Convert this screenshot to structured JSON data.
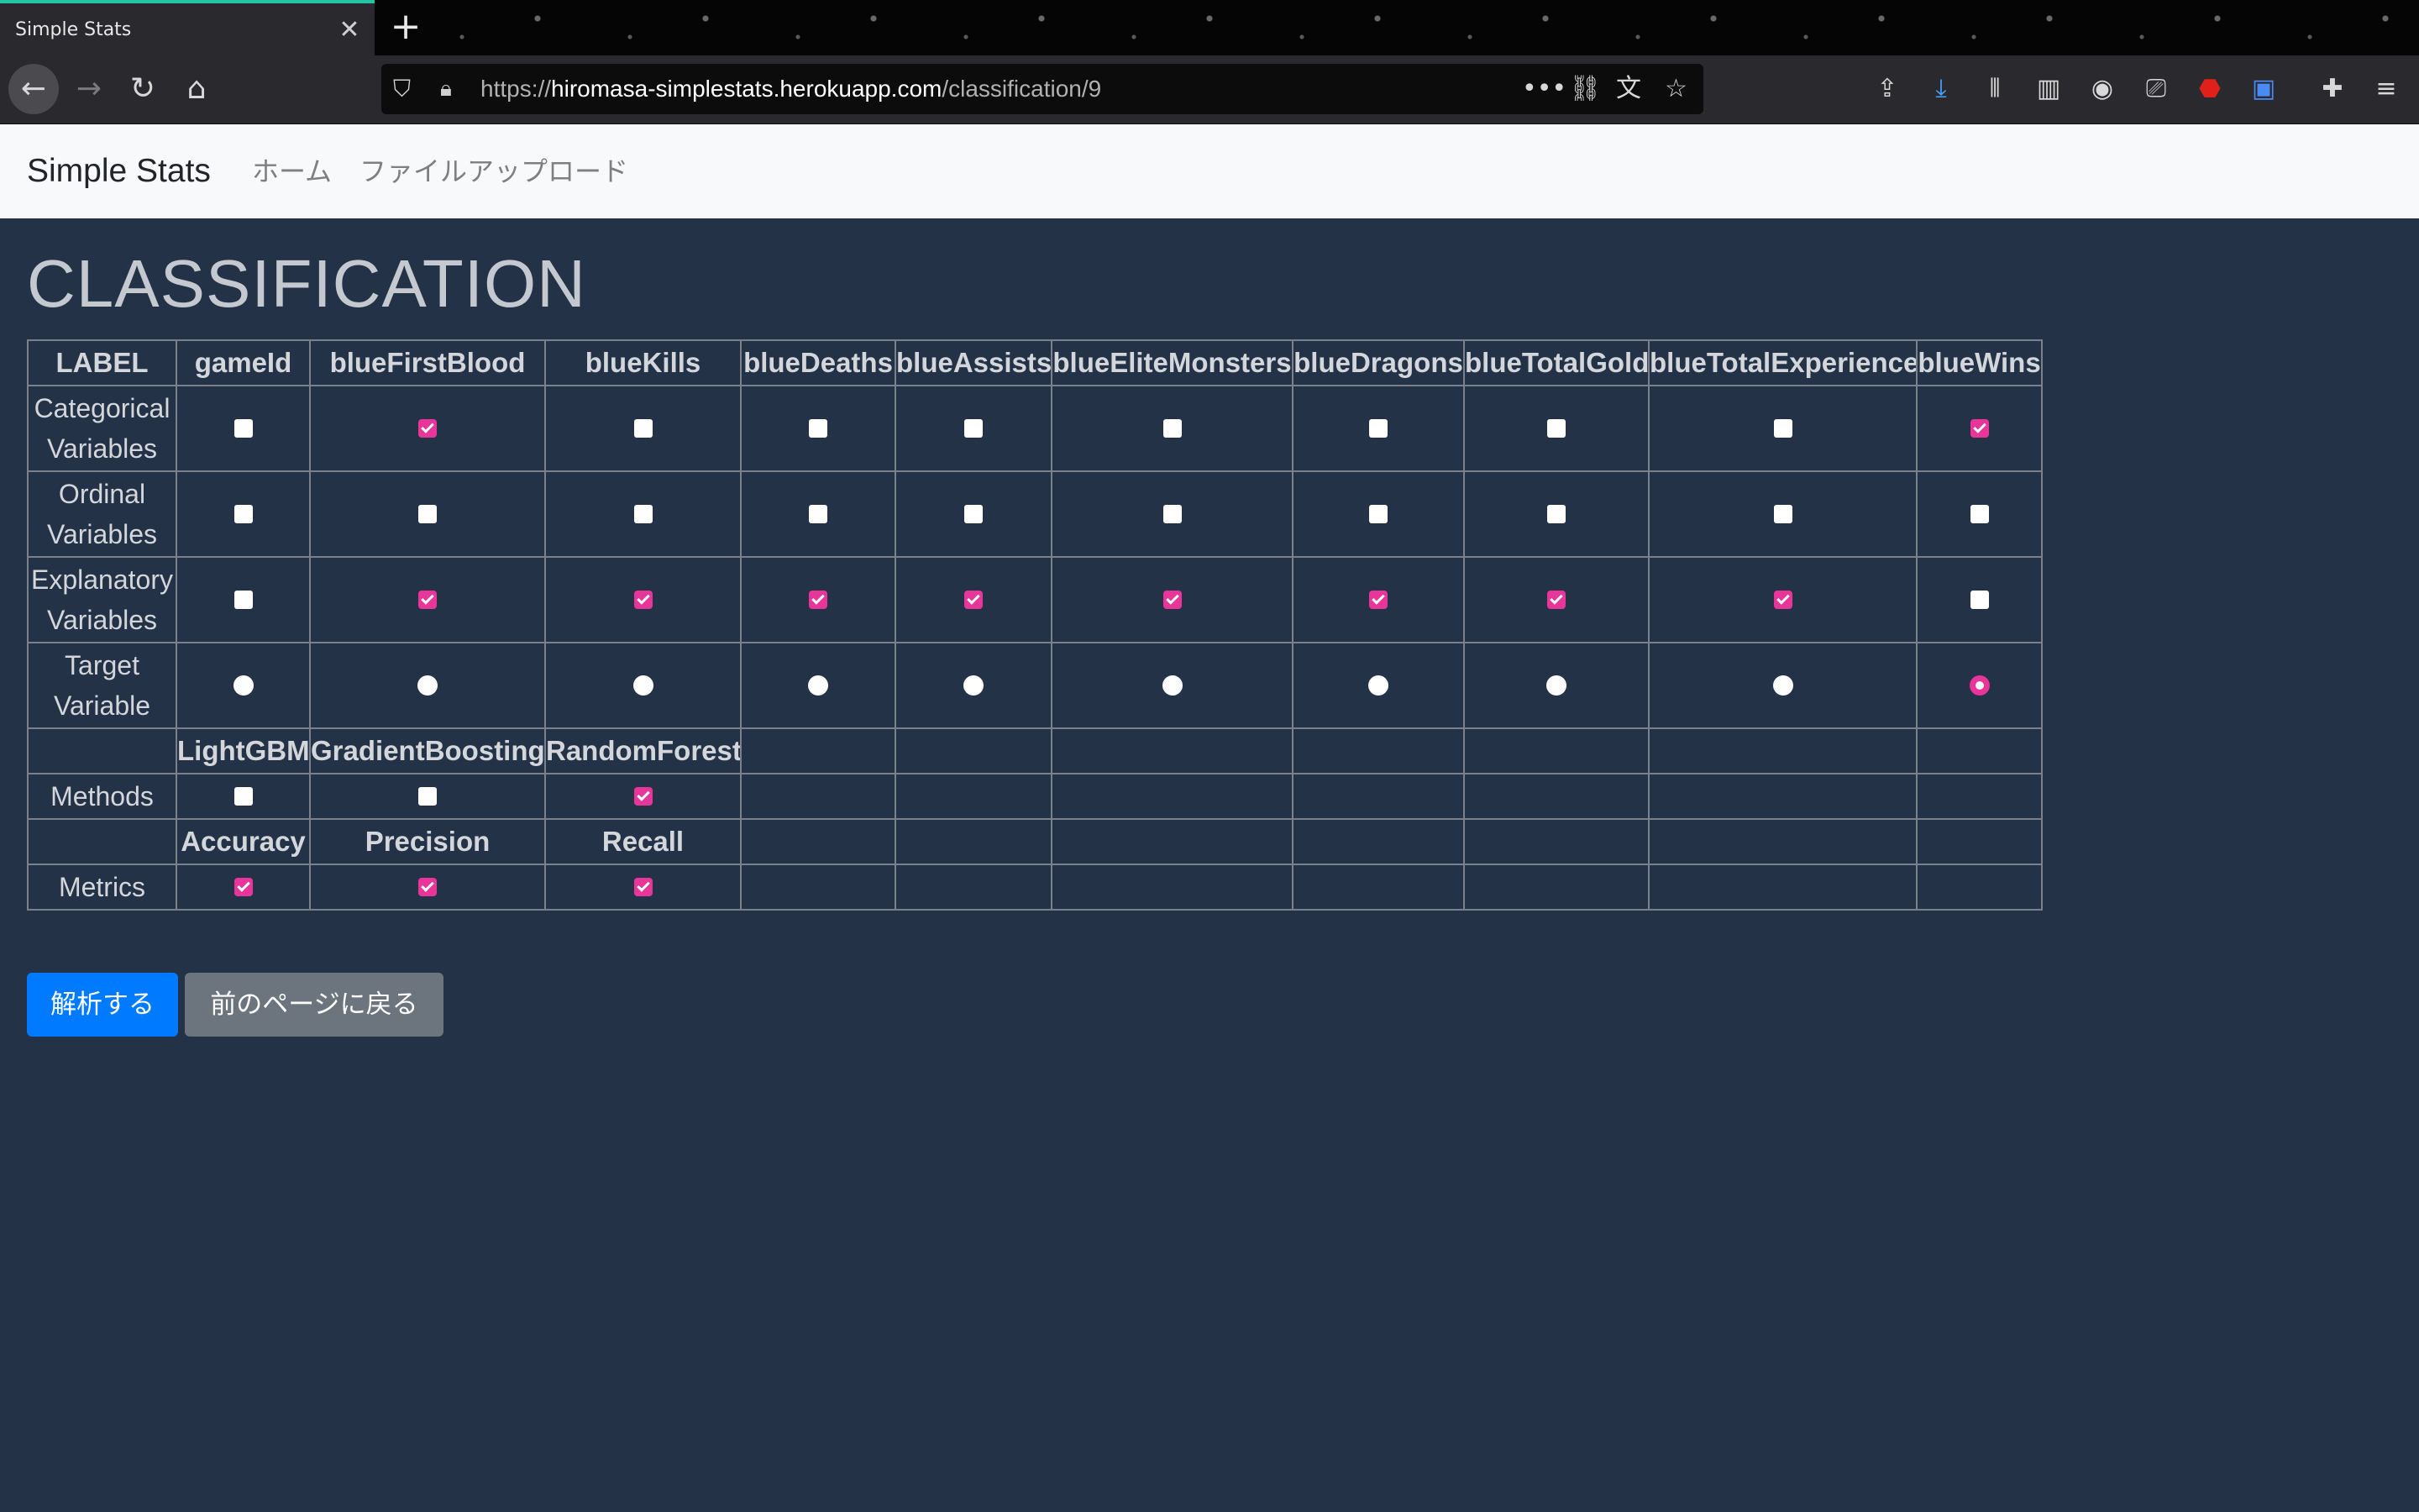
{
  "browser": {
    "tab_title": "Simple Stats",
    "tab_close": "✕",
    "new_tab": "+",
    "url_prefix": "https://",
    "url_host": "hiromasa-simplestats.herokuapp.com",
    "url_path": "/classification/9",
    "nav_icons": [
      "back-icon",
      "forward-icon",
      "reload-icon",
      "home-icon"
    ],
    "toolbar_icons": [
      "pocket-save-icon",
      "download-icon",
      "library-icon",
      "sidebar-icon",
      "account-icon",
      "screenshot-icon",
      "ublock-icon",
      "translate-icon",
      "extensions-icon",
      "menu-icon"
    ]
  },
  "navbar": {
    "brand": "Simple Stats",
    "links": [
      "ホーム",
      "ファイルアップロード"
    ]
  },
  "page": {
    "title": "CLASSIFICATION"
  },
  "table": {
    "label_header": "LABEL",
    "columns": [
      "gameId",
      "blueFirstBlood",
      "blueKills",
      "blueDeaths",
      "blueAssists",
      "blueEliteMonsters",
      "blueDragons",
      "blueTotalGold",
      "blueTotalExperience",
      "blueWins"
    ],
    "rows": {
      "categorical": {
        "label_line1": "Categorical",
        "label_line2": "Variables",
        "values": [
          false,
          true,
          false,
          false,
          false,
          false,
          false,
          false,
          false,
          true
        ]
      },
      "ordinal": {
        "label_line1": "Ordinal",
        "label_line2": "Variables",
        "values": [
          false,
          false,
          false,
          false,
          false,
          false,
          false,
          false,
          false,
          false
        ]
      },
      "explanatory": {
        "label_line1": "Explanatory",
        "label_line2": "Variables",
        "values": [
          false,
          true,
          true,
          true,
          true,
          true,
          true,
          true,
          true,
          false
        ]
      },
      "target": {
        "label_line1": "Target",
        "label_line2": "Variable",
        "selected": "blueWins"
      }
    },
    "methods": {
      "label": "Methods",
      "names": [
        "LightGBM",
        "GradientBoosting",
        "RandomForest"
      ],
      "values": [
        false,
        false,
        true
      ]
    },
    "metrics": {
      "label": "Metrics",
      "names": [
        "Accuracy",
        "Precision",
        "Recall"
      ],
      "values": [
        true,
        true,
        true
      ]
    }
  },
  "buttons": {
    "analyze": "解析する",
    "back": "前のページに戻る"
  },
  "colors": {
    "background": "#243247",
    "checkbox_on": "#e7359a",
    "primary": "#007bff",
    "secondary": "#6c757d"
  }
}
